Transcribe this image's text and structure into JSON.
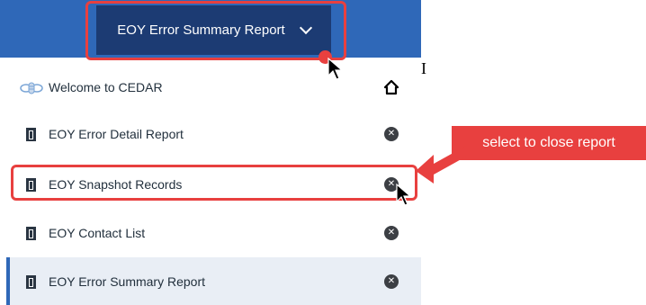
{
  "header": {
    "dropdown_label": "EOY Error Summary Report"
  },
  "menu": {
    "items": [
      {
        "label": "Welcome to CEDAR",
        "icon": "bee-icon",
        "action_icon": "home-icon"
      },
      {
        "label": "EOY Error Detail Report",
        "icon": "document-icon",
        "action_icon": "close-icon"
      },
      {
        "label": "EOY Snapshot Records",
        "icon": "document-icon",
        "action_icon": "close-icon"
      },
      {
        "label": "EOY Contact List",
        "icon": "document-icon",
        "action_icon": "close-icon"
      },
      {
        "label": "EOY Error Summary Report",
        "icon": "document-icon",
        "action_icon": "close-icon",
        "active": true
      }
    ]
  },
  "annotation": {
    "callout_text": "select to close report",
    "color": "#e8403f"
  },
  "colors": {
    "header_bg": "#2f68b8",
    "dropdown_bg": "#1c3b73",
    "active_row_bg": "#e9eef5"
  }
}
